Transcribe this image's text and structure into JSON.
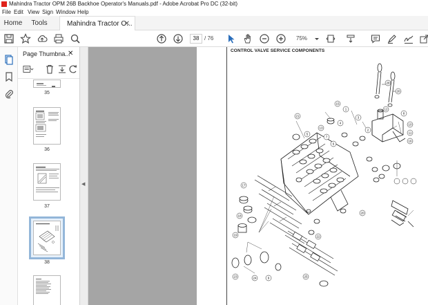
{
  "window": {
    "title": "Mahindra Tractor OPM 26B Backhoe Operator's Manuals.pdf - Adobe Acrobat Pro DC (32-bit)"
  },
  "menu": [
    "File",
    "Edit",
    "View",
    "Sign",
    "Window",
    "Help"
  ],
  "tabs": {
    "home": "Home",
    "tools": "Tools",
    "document": "Mahindra Tractor O..."
  },
  "toolbar": {
    "current_page": "38",
    "total_pages": "/ 76",
    "zoom": "75%"
  },
  "thumbnails": {
    "title": "Page Thumbna...",
    "pages": [
      "35",
      "36",
      "37",
      "38"
    ],
    "selected": "38"
  },
  "page": {
    "heading": "CONTROL VALVE SERVICE COMPONENTS",
    "callouts": [
      "28",
      "26",
      "21",
      "15",
      "13",
      "7",
      "6",
      "5",
      "4",
      "3",
      "2",
      "1",
      "12",
      "8",
      "10",
      "11",
      "16",
      "17",
      "18",
      "19",
      "20",
      "22",
      "25",
      "23",
      "24",
      "9"
    ]
  }
}
